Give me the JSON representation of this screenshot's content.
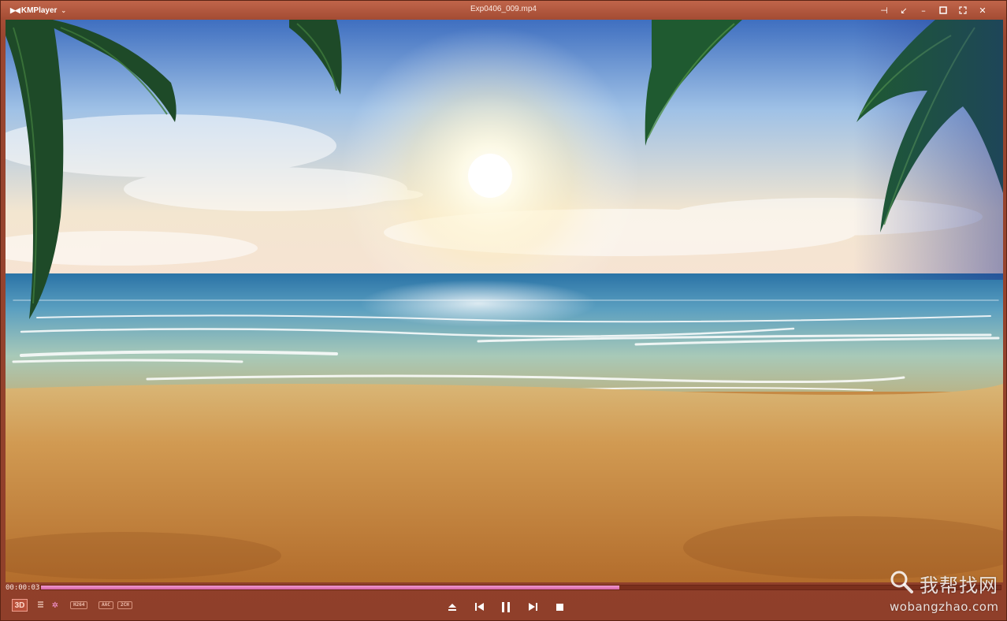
{
  "app": {
    "name": "KMPlayer",
    "file_title": "Exp0406_009.mp4"
  },
  "icons": {
    "menu": "chevron-down-icon",
    "pin": "pin-icon",
    "compact": "compact-mode-icon",
    "minimize": "minimize-icon",
    "maximize": "maximize-icon",
    "fullscreen": "fullscreen-icon",
    "close": "close-icon"
  },
  "playback": {
    "current_time": "00:00:03",
    "progress_fraction": 0.603
  },
  "controls": {
    "three_d_label": "3D",
    "codecs": [
      "H264",
      "AAC",
      "2CH"
    ]
  },
  "colors": {
    "frame": "#9a4630",
    "seek_fill": "#e07ab8"
  },
  "watermark": {
    "cn_text": "我帮找网",
    "url": "wobangzhao.com"
  }
}
